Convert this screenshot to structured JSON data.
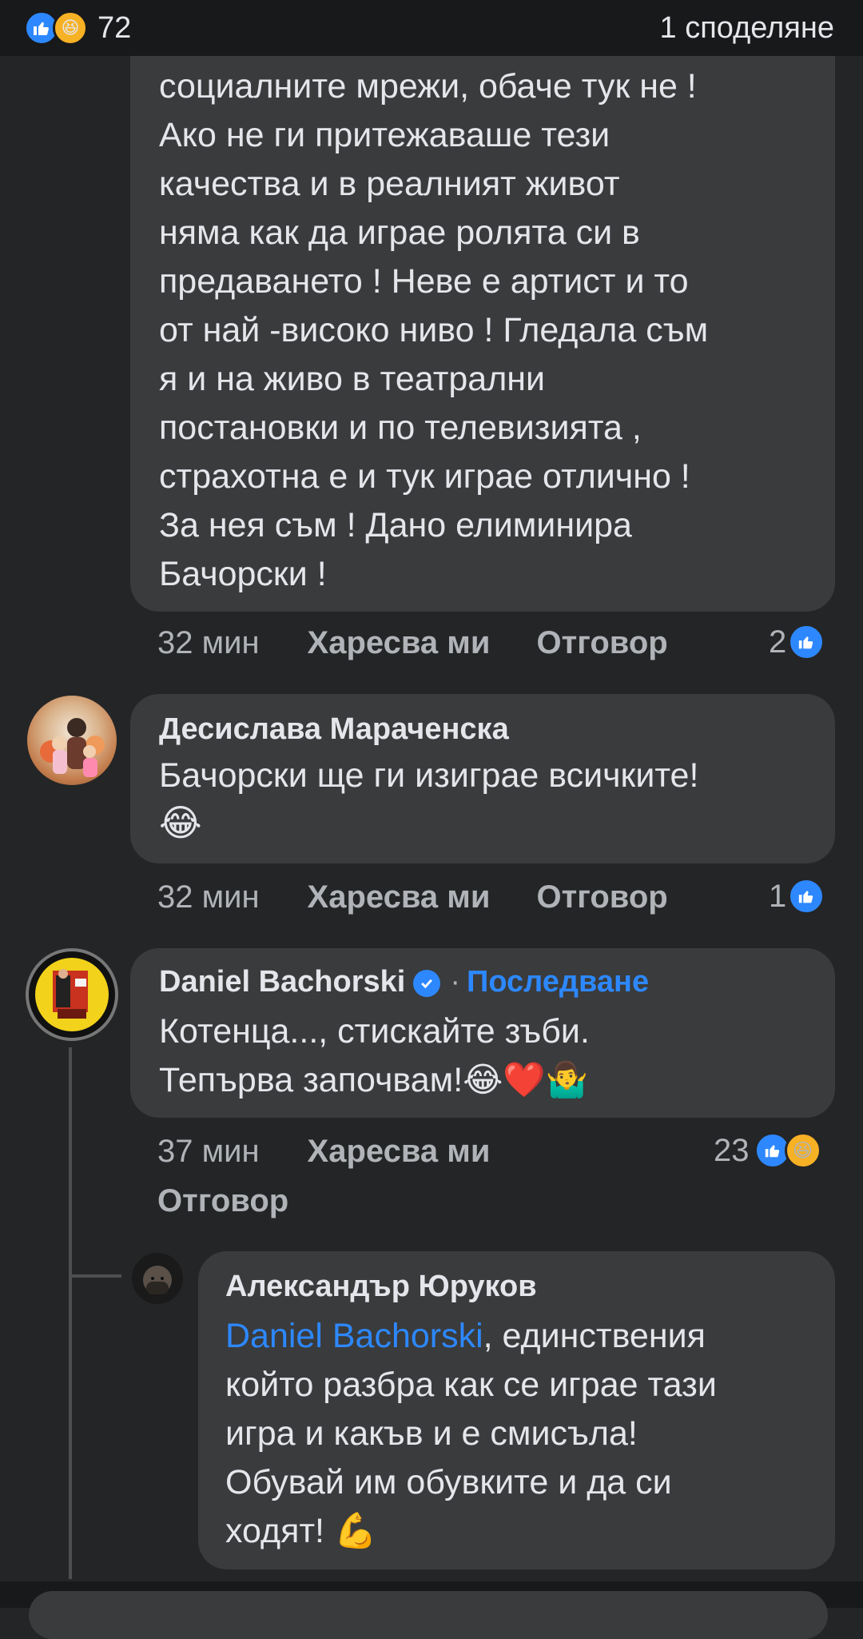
{
  "header": {
    "reaction_count": "72",
    "shares": "1 споделяне"
  },
  "comment1": {
    "lines": [
      "социалните мрежи, обаче тук не !",
      "Ако не ги притежаваше тези",
      "качества и в реалният живот",
      "няма как да играе ролята си в",
      "предаването ! Неве е артист и то",
      "от най -високо ниво ! Гледала съм",
      "я и на живо в театрални",
      "постановки и по телевизията ,",
      "страхотна е и тук играе отлично  !",
      "За нея съм ! Дано елиминира",
      "Бачорски !"
    ],
    "time": "32 мин",
    "like_label": "Харесва ми",
    "reply_label": "Отговор",
    "likes": "2"
  },
  "comment2": {
    "author": "Десислава Мараченска",
    "text": "Бачорски ще ги изиграе всичките!",
    "emoji": "😂",
    "time": "32 мин",
    "like_label": "Харесва ми",
    "reply_label": "Отговор",
    "likes": "1"
  },
  "comment3": {
    "author": "Daniel Bachorski",
    "dot": "·",
    "follow_label": "Последване",
    "line1": "Котенца..., стискайте зъби.",
    "line2": "Тепърва започвам!",
    "emojis": "😂❤️🤷‍♂️",
    "time": "37 мин",
    "like_label": "Харесва ми",
    "reply_label": "Отговор",
    "likes": "23"
  },
  "reply1": {
    "author": "Александър Юруков",
    "mention": "Daniel Bachorski",
    "line1_rest": ", единствения",
    "lines": [
      "който разбра как се играе тази",
      "игра и какъв и е смисъла!",
      "Обувай им обувките и да си"
    ],
    "last_line": "ходят! ",
    "emoji": "💪"
  },
  "icons": {
    "like": "thumbs-up-icon",
    "haha": "laughing-face-icon",
    "verified": "verified-badge-icon"
  },
  "colors": {
    "background": "#242526",
    "bubble": "#3a3b3c",
    "accent": "#2d88ff",
    "secondary_text": "#b0b3b8"
  }
}
